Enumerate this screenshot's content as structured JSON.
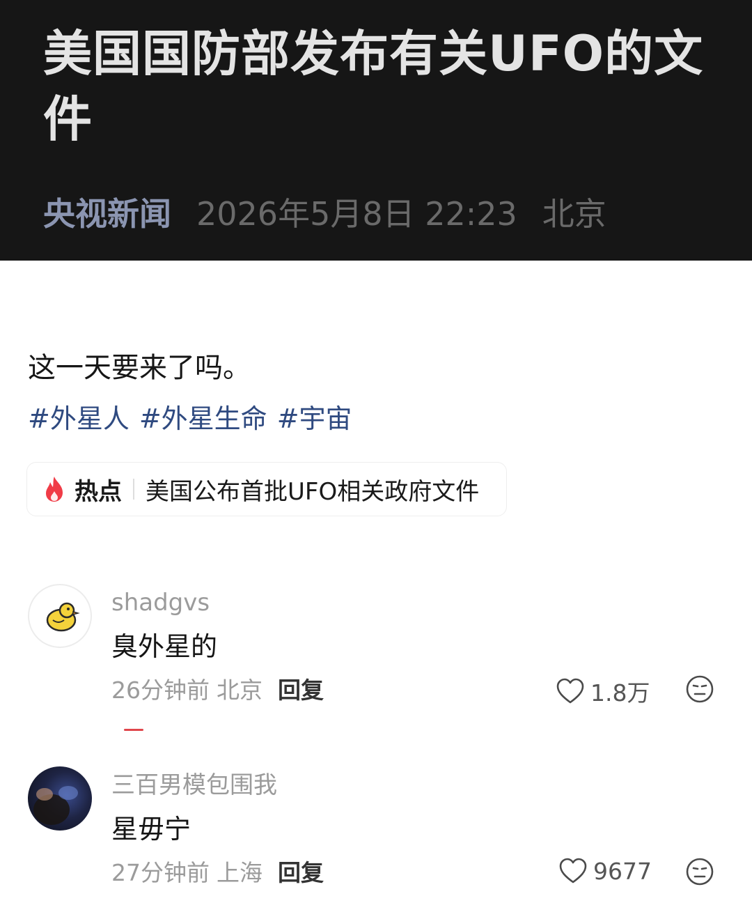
{
  "news_card": {
    "title": "美国国防部发布有关UFO的文件",
    "source": "央视新闻",
    "time": "2026年5月8日 22:23",
    "location": "北京"
  },
  "post": {
    "text": "这一天要来了吗。",
    "hashtags": [
      "#外星人",
      "#外星生命",
      "#宇宙"
    ]
  },
  "hot_topic": {
    "label": "热点",
    "text": "美国公布首批UFO相关政府文件",
    "icon": "flame-icon",
    "icon_color": "#f03c47"
  },
  "comments": [
    {
      "username": "shadgvs",
      "text": "臭外星的",
      "time": "26分钟前",
      "location": "北京",
      "reply_label": "回复",
      "likes": "1.8万",
      "avatar_icon": "yellow-duck-avatar"
    },
    {
      "username": "三百男模包围我",
      "text": "星毋宁",
      "time": "27分钟前",
      "location": "上海",
      "reply_label": "回复",
      "likes": "9677",
      "avatar_icon": "dark-photo-avatar"
    }
  ]
}
